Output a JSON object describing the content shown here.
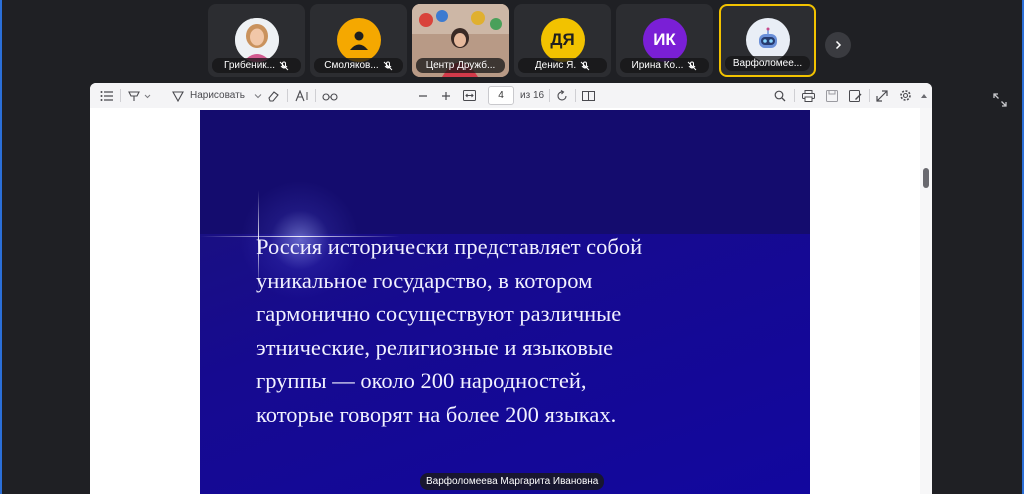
{
  "participants": [
    {
      "name": "Грибеник...",
      "avatar": "photo",
      "muted": true
    },
    {
      "name": "Смоляков...",
      "avatar": "person-icon",
      "avatar_color": "#f5a800",
      "muted": true
    },
    {
      "name": "Центр Дружб...",
      "avatar": "video",
      "muted": false
    },
    {
      "name": "Денис Я.",
      "initials": "ДЯ",
      "avatar_color": "#f2c200",
      "muted": true
    },
    {
      "name": "Ирина Ко...",
      "initials": "ИК",
      "avatar_color": "#7a1fd6",
      "muted": true
    },
    {
      "name": "Варфоломее...",
      "avatar": "robot-icon",
      "active": true,
      "muted": false
    }
  ],
  "toolbar": {
    "draw_label": "Нарисовать",
    "page_current": "4",
    "page_total": "из 16"
  },
  "slide": {
    "lines": [
      "Россия исторически представляет собой",
      "уникальное государство, в котором",
      "гармонично сосуществуют различные",
      "этнические, религиозные и языковые",
      "группы — около 200 народностей,",
      "которые говорят на более 200 языках."
    ]
  },
  "speaker": "Варфоломеева Маргарита Ивановна",
  "colors": {
    "active_border": "#f2c200",
    "slide_background": "#160a90",
    "frame": "#2b6fd8"
  }
}
